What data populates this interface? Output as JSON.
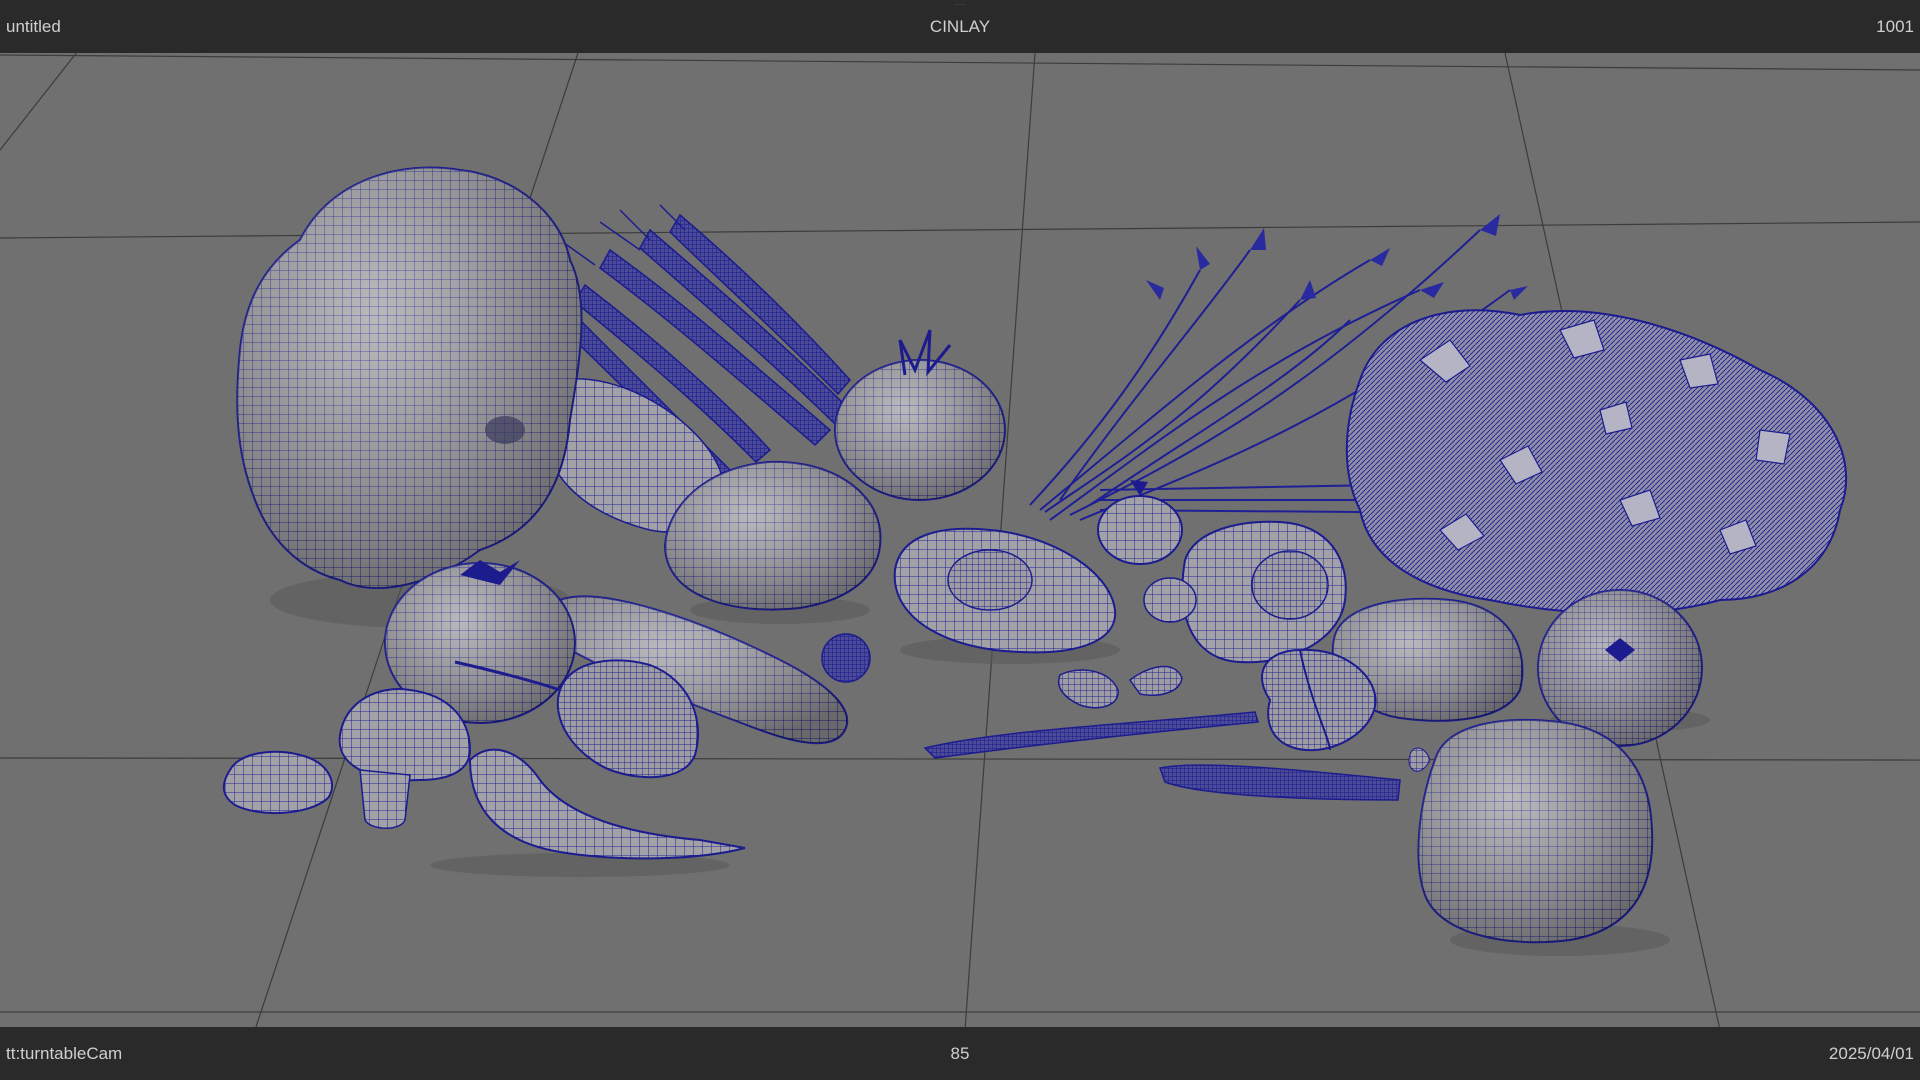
{
  "hud": {
    "top_left": "untitled",
    "top_center": "CINLAY",
    "top_right": "1001",
    "top_indicator": "······",
    "bottom_left": "tt:turntableCam",
    "bottom_center": "85",
    "bottom_right": "2025/04/01"
  },
  "colors": {
    "viewport_bg": "#707070",
    "hud_bg": "#2a2a2a",
    "hud_text": "#cfcfcf",
    "wireframe": "#1d1d8a",
    "mesh_shade": "#9a9a9a",
    "grid_line": "#3c3c3c"
  },
  "scene": {
    "objects": [
      "cauliflower",
      "carrots",
      "tomato",
      "avocado",
      "avocado-half",
      "onion",
      "shallot",
      "herb-bunch",
      "leafy-greens",
      "cucumber",
      "mushroom",
      "chili-pepper",
      "bell-pepper",
      "pea-pod",
      "garlic-clove",
      "green-bean",
      "raspberry",
      "potato"
    ]
  }
}
